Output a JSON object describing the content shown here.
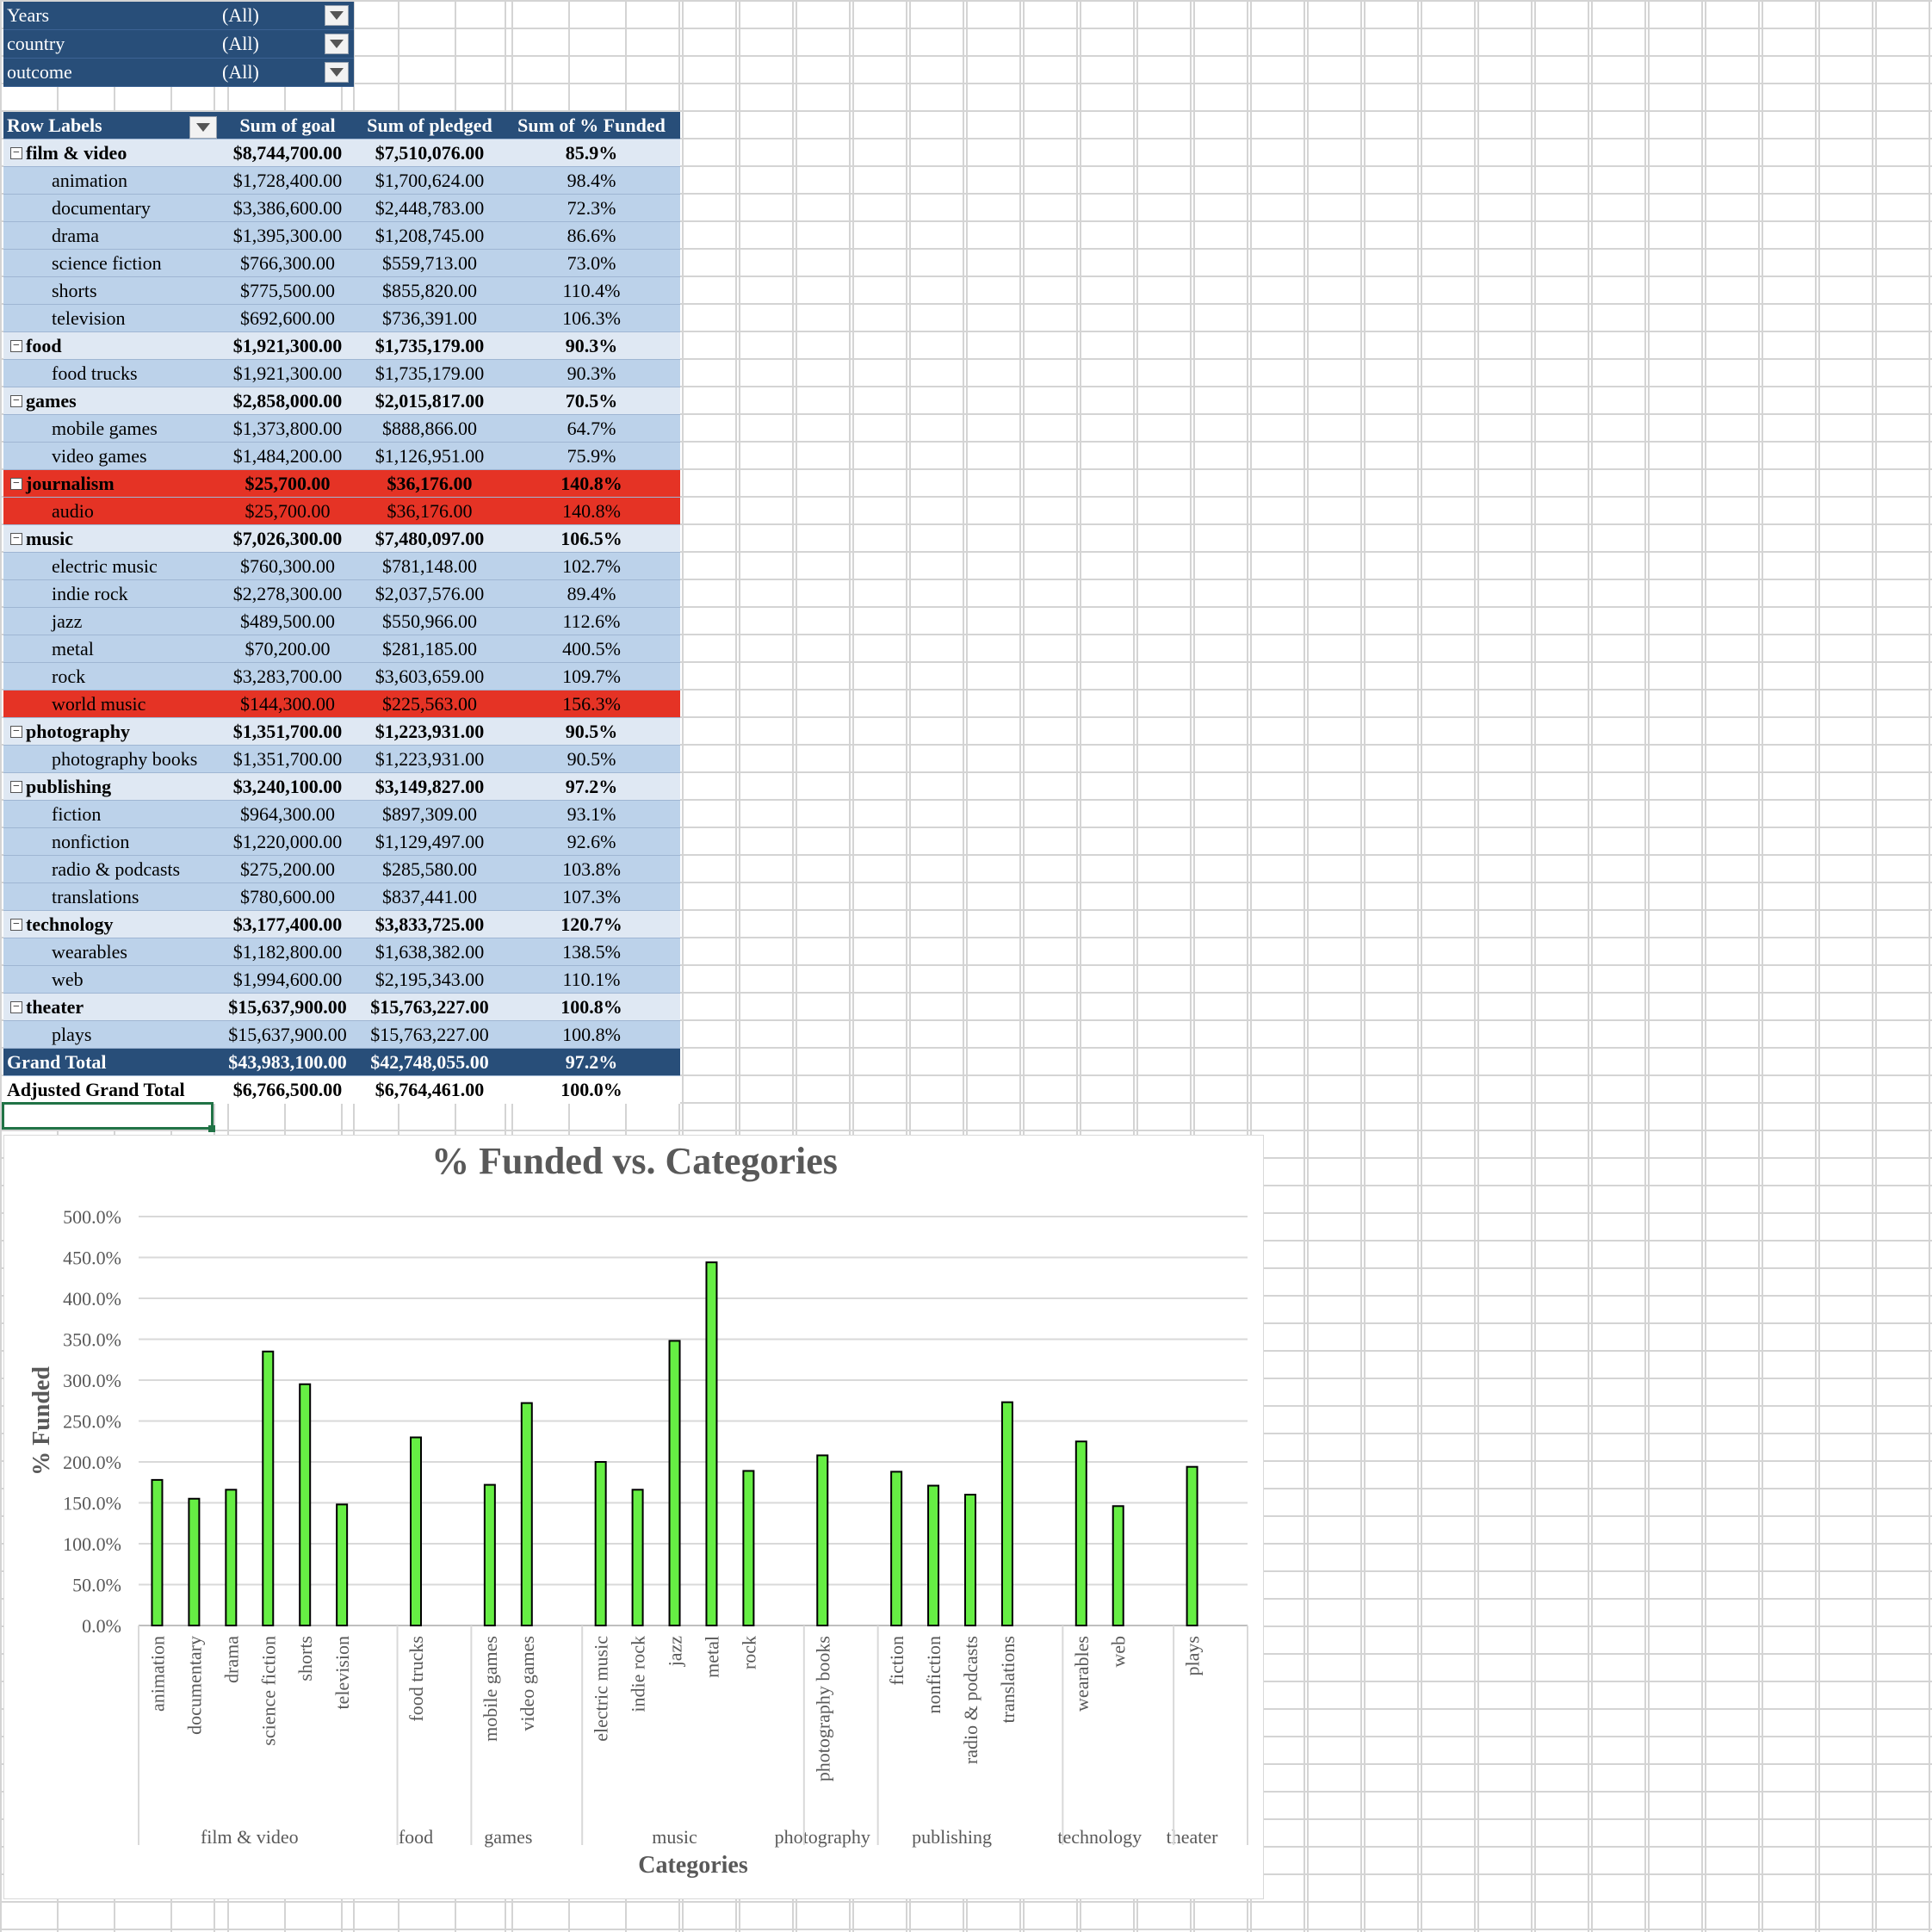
{
  "filters": [
    {
      "label": "Years",
      "value": "(All)"
    },
    {
      "label": "country",
      "value": "(All)"
    },
    {
      "label": "outcome",
      "value": "(All)"
    }
  ],
  "pivot": {
    "headers": {
      "row_labels": "Row Labels",
      "goal": "Sum of goal",
      "pledged": "Sum of pledged",
      "funded": "Sum of % Funded"
    },
    "rows": [
      {
        "type": "parent",
        "label": "film & video",
        "goal": "$8,744,700.00",
        "pledged": "$7,510,076.00",
        "funded": "85.9%"
      },
      {
        "type": "child",
        "label": "animation",
        "goal": "$1,728,400.00",
        "pledged": "$1,700,624.00",
        "funded": "98.4%"
      },
      {
        "type": "child",
        "label": "documentary",
        "goal": "$3,386,600.00",
        "pledged": "$2,448,783.00",
        "funded": "72.3%"
      },
      {
        "type": "child",
        "label": "drama",
        "goal": "$1,395,300.00",
        "pledged": "$1,208,745.00",
        "funded": "86.6%"
      },
      {
        "type": "child",
        "label": "science fiction",
        "goal": "$766,300.00",
        "pledged": "$559,713.00",
        "funded": "73.0%"
      },
      {
        "type": "child",
        "label": "shorts",
        "goal": "$775,500.00",
        "pledged": "$855,820.00",
        "funded": "110.4%"
      },
      {
        "type": "child",
        "label": "television",
        "goal": "$692,600.00",
        "pledged": "$736,391.00",
        "funded": "106.3%"
      },
      {
        "type": "parent",
        "label": "food",
        "goal": "$1,921,300.00",
        "pledged": "$1,735,179.00",
        "funded": "90.3%"
      },
      {
        "type": "child",
        "label": "food trucks",
        "goal": "$1,921,300.00",
        "pledged": "$1,735,179.00",
        "funded": "90.3%"
      },
      {
        "type": "parent",
        "label": "games",
        "goal": "$2,858,000.00",
        "pledged": "$2,015,817.00",
        "funded": "70.5%"
      },
      {
        "type": "child",
        "label": "mobile games",
        "goal": "$1,373,800.00",
        "pledged": "$888,866.00",
        "funded": "64.7%"
      },
      {
        "type": "child",
        "label": "video games",
        "goal": "$1,484,200.00",
        "pledged": "$1,126,951.00",
        "funded": "75.9%"
      },
      {
        "type": "parent",
        "label": "journalism",
        "goal": "$25,700.00",
        "pledged": "$36,176.00",
        "funded": "140.8%",
        "highlight": true
      },
      {
        "type": "child",
        "label": "audio",
        "goal": "$25,700.00",
        "pledged": "$36,176.00",
        "funded": "140.8%",
        "highlight": true
      },
      {
        "type": "parent",
        "label": "music",
        "goal": "$7,026,300.00",
        "pledged": "$7,480,097.00",
        "funded": "106.5%"
      },
      {
        "type": "child",
        "label": "electric music",
        "goal": "$760,300.00",
        "pledged": "$781,148.00",
        "funded": "102.7%"
      },
      {
        "type": "child",
        "label": "indie rock",
        "goal": "$2,278,300.00",
        "pledged": "$2,037,576.00",
        "funded": "89.4%"
      },
      {
        "type": "child",
        "label": "jazz",
        "goal": "$489,500.00",
        "pledged": "$550,966.00",
        "funded": "112.6%"
      },
      {
        "type": "child",
        "label": "metal",
        "goal": "$70,200.00",
        "pledged": "$281,185.00",
        "funded": "400.5%"
      },
      {
        "type": "child",
        "label": "rock",
        "goal": "$3,283,700.00",
        "pledged": "$3,603,659.00",
        "funded": "109.7%"
      },
      {
        "type": "child",
        "label": "world music",
        "goal": "$144,300.00",
        "pledged": "$225,563.00",
        "funded": "156.3%",
        "highlight": true
      },
      {
        "type": "parent",
        "label": "photography",
        "goal": "$1,351,700.00",
        "pledged": "$1,223,931.00",
        "funded": "90.5%"
      },
      {
        "type": "child",
        "label": "photography books",
        "goal": "$1,351,700.00",
        "pledged": "$1,223,931.00",
        "funded": "90.5%"
      },
      {
        "type": "parent",
        "label": "publishing",
        "goal": "$3,240,100.00",
        "pledged": "$3,149,827.00",
        "funded": "97.2%"
      },
      {
        "type": "child",
        "label": "fiction",
        "goal": "$964,300.00",
        "pledged": "$897,309.00",
        "funded": "93.1%"
      },
      {
        "type": "child",
        "label": "nonfiction",
        "goal": "$1,220,000.00",
        "pledged": "$1,129,497.00",
        "funded": "92.6%"
      },
      {
        "type": "child",
        "label": "radio & podcasts",
        "goal": "$275,200.00",
        "pledged": "$285,580.00",
        "funded": "103.8%"
      },
      {
        "type": "child",
        "label": "translations",
        "goal": "$780,600.00",
        "pledged": "$837,441.00",
        "funded": "107.3%"
      },
      {
        "type": "parent",
        "label": "technology",
        "goal": "$3,177,400.00",
        "pledged": "$3,833,725.00",
        "funded": "120.7%"
      },
      {
        "type": "child",
        "label": "wearables",
        "goal": "$1,182,800.00",
        "pledged": "$1,638,382.00",
        "funded": "138.5%"
      },
      {
        "type": "child",
        "label": "web",
        "goal": "$1,994,600.00",
        "pledged": "$2,195,343.00",
        "funded": "110.1%"
      },
      {
        "type": "parent",
        "label": "theater",
        "goal": "$15,637,900.00",
        "pledged": "$15,763,227.00",
        "funded": "100.8%"
      },
      {
        "type": "child",
        "label": "plays",
        "goal": "$15,637,900.00",
        "pledged": "$15,763,227.00",
        "funded": "100.8%"
      }
    ],
    "grand_total": {
      "label": "Grand Total",
      "goal": "$43,983,100.00",
      "pledged": "$42,748,055.00",
      "funded": "97.2%"
    },
    "adjusted_total": {
      "label": "Adjusted Grand Total",
      "goal": "$6,766,500.00",
      "pledged": "$6,764,461.00",
      "funded": "100.0%"
    }
  },
  "colors": {
    "header_blue": "#284e79",
    "parent_row": "#dfe8f3",
    "child_row": "#bcd2ea",
    "highlight_red": "#e53325",
    "bar_green": "#66ee44"
  },
  "chart_data": {
    "type": "bar",
    "title": "% Funded vs. Categories",
    "xlabel": "Categories",
    "ylabel": "% Funded",
    "ylim": [
      0,
      500
    ],
    "yticks": [
      "0.0%",
      "50.0%",
      "100.0%",
      "150.0%",
      "200.0%",
      "250.0%",
      "300.0%",
      "350.0%",
      "400.0%",
      "450.0%",
      "500.0%"
    ],
    "grid": true,
    "legend": "none",
    "groups": [
      {
        "name": "film & video",
        "categories": [
          "animation",
          "documentary",
          "drama",
          "science fiction",
          "shorts",
          "television"
        ],
        "values": [
          178,
          155,
          166,
          335,
          295,
          148
        ]
      },
      {
        "name": "food",
        "categories": [
          "food trucks"
        ],
        "values": [
          230
        ]
      },
      {
        "name": "games",
        "categories": [
          "mobile games",
          "video games"
        ],
        "values": [
          172,
          272
        ]
      },
      {
        "name": "music",
        "categories": [
          "electric music",
          "indie rock",
          "jazz",
          "metal",
          "rock"
        ],
        "values": [
          200,
          166,
          348,
          444,
          189
        ]
      },
      {
        "name": "photography",
        "categories": [
          "photography books"
        ],
        "values": [
          208
        ]
      },
      {
        "name": "publishing",
        "categories": [
          "fiction",
          "nonfiction",
          "radio & podcasts",
          "translations"
        ],
        "values": [
          188,
          171,
          160,
          273
        ]
      },
      {
        "name": "technology",
        "categories": [
          "wearables",
          "web"
        ],
        "values": [
          225,
          146
        ]
      },
      {
        "name": "theater",
        "categories": [
          "plays"
        ],
        "values": [
          194
        ]
      }
    ]
  }
}
